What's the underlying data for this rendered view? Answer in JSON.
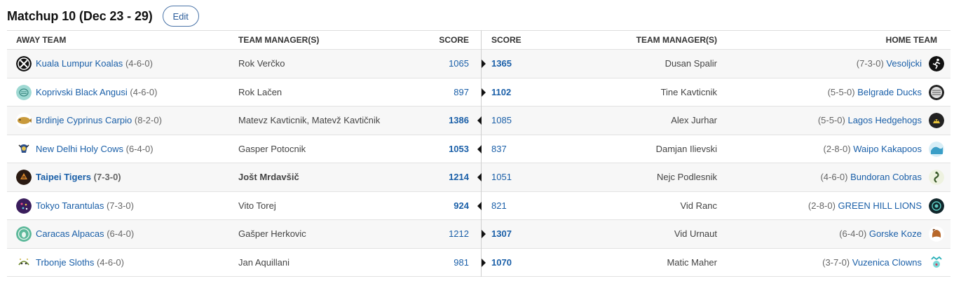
{
  "header": {
    "title": "Matchup 10 (Dec 23 - 29)",
    "edit_label": "Edit"
  },
  "away_headers": {
    "team": "AWAY TEAM",
    "manager": "TEAM MANAGER(S)",
    "score": "SCORE"
  },
  "home_headers": {
    "score": "SCORE",
    "manager": "TEAM MANAGER(S)",
    "team": "HOME TEAM"
  },
  "colors": {
    "link": "#1a5fa8",
    "arrow": "#111111"
  },
  "matchups": [
    {
      "away": {
        "name": "Kuala Lumpur Koalas",
        "record": "(4-6-0)",
        "manager": "Rok Verčko",
        "score": "1065",
        "icon": "koala-logo-icon"
      },
      "home": {
        "name": "Vesoljcki",
        "record": "(7-3-0)",
        "manager": "Dusan Spalir",
        "score": "1365",
        "icon": "running-figure-logo-icon"
      },
      "winner": "home"
    },
    {
      "away": {
        "name": "Koprivski Black Angusi",
        "record": "(4-6-0)",
        "manager": "Rok Lačen",
        "score": "897",
        "icon": "angus-logo-icon"
      },
      "home": {
        "name": "Belgrade Ducks",
        "record": "(5-5-0)",
        "manager": "Tine Kavticnik",
        "score": "1102",
        "icon": "duck-logo-icon"
      },
      "winner": "home"
    },
    {
      "away": {
        "name": "Brdinje Cyprinus Carpio",
        "record": "(8-2-0)",
        "manager": "Matevz Kavticnik, Matevž Kavtičnik",
        "score": "1386",
        "icon": "carp-logo-icon"
      },
      "home": {
        "name": "Lagos Hedgehogs",
        "record": "(5-5-0)",
        "manager": "Alex Jurhar",
        "score": "1085",
        "icon": "hedgehog-logo-icon"
      },
      "winner": "away"
    },
    {
      "away": {
        "name": "New Delhi Holy Cows",
        "record": "(6-4-0)",
        "manager": "Gasper Potocnik",
        "score": "1053",
        "icon": "cow-logo-icon"
      },
      "home": {
        "name": "Waipo Kakapoos",
        "record": "(2-8-0)",
        "manager": "Damjan Ilievski",
        "score": "837",
        "icon": "wave-logo-icon"
      },
      "winner": "away"
    },
    {
      "away": {
        "name": "Taipei Tigers",
        "record": "(7-3-0)",
        "manager": "Jošt Mrdavšič",
        "score": "1214",
        "icon": "tiger-logo-icon",
        "highlight": true
      },
      "home": {
        "name": "Bundoran Cobras",
        "record": "(4-6-0)",
        "manager": "Nejc Podlesnik",
        "score": "1051",
        "icon": "cobra-logo-icon"
      },
      "winner": "away"
    },
    {
      "away": {
        "name": "Tokyo Tarantulas",
        "record": "(7-3-0)",
        "manager": "Vito Torej",
        "score": "924",
        "icon": "tarantula-logo-icon"
      },
      "home": {
        "name": "GREEN HILL LIONS",
        "record": "(2-8-0)",
        "manager": "Vid Ranc",
        "score": "821",
        "icon": "lion-logo-icon"
      },
      "winner": "away"
    },
    {
      "away": {
        "name": "Caracas Alpacas",
        "record": "(6-4-0)",
        "manager": "Gašper Herkovic",
        "score": "1212",
        "icon": "alpaca-logo-icon"
      },
      "home": {
        "name": "Gorske Koze",
        "record": "(6-4-0)",
        "manager": "Vid Urnaut",
        "score": "1307",
        "icon": "goat-logo-icon"
      },
      "winner": "home"
    },
    {
      "away": {
        "name": "Trbonje Sloths",
        "record": "(4-6-0)",
        "manager": "Jan Aquillani",
        "score": "981",
        "icon": "sloth-logo-icon"
      },
      "home": {
        "name": "Vuzenica Clowns",
        "record": "(3-7-0)",
        "manager": "Matic Maher",
        "score": "1070",
        "icon": "clown-logo-icon"
      },
      "winner": "home"
    }
  ]
}
